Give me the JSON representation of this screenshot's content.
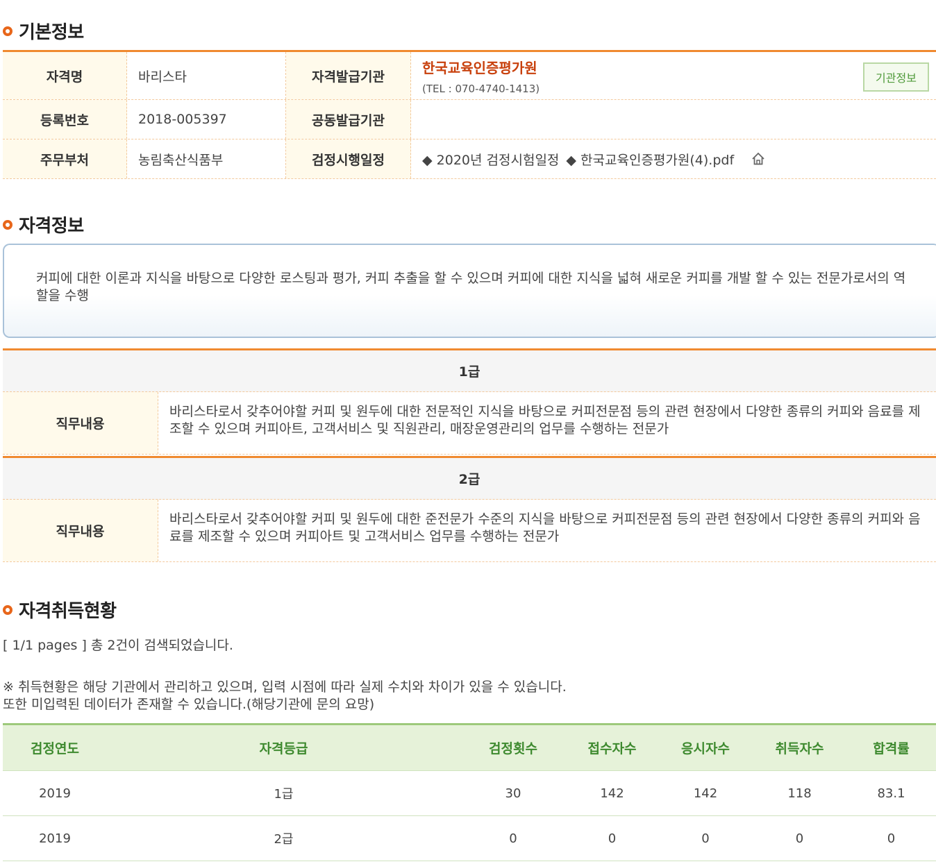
{
  "sections": {
    "basic_title": "기본정보",
    "qual_title": "자격정보",
    "status_title": "자격취득현황"
  },
  "basic": {
    "name_label": "자격명",
    "name_value": "바리스타",
    "issuer_label": "자격발급기관",
    "issuer_name": "한국교육인증평가원",
    "issuer_tel": "(TEL : 070-4740-1413)",
    "org_button": "기관정보",
    "reg_label": "등록번호",
    "reg_value": "2018-005397",
    "joint_label": "공동발급기관",
    "joint_value": "",
    "ministry_label": "주무부처",
    "ministry_value": "농림축산식품부",
    "schedule_label": "검정시행일정",
    "schedule_item1": "◆ 2020년 검정시험일정",
    "schedule_item2": "◆ 한국교육인증평가원(4).pdf"
  },
  "qual_desc": "커피에 대한 이론과 지식을 바탕으로 다양한 로스팅과 평가, 커피 추출을 할 수 있으며 커피에 대한 지식을 넓혀 새로운 커피를 개발 할 수 있는 전문가로서의 역할을 수행",
  "grades": [
    {
      "name": "1급",
      "duty_label": "직무내용",
      "duty": "바리스타로서 갖추어야할 커피 및 원두에 대한 전문적인 지식을 바탕으로 커피전문점 등의 관련 현장에서 다양한 종류의 커피와 음료를 제조할 수 있으며 커피아트, 고객서비스 및 직원관리, 매장운영관리의 업무를 수행하는 전문가"
    },
    {
      "name": "2급",
      "duty_label": "직무내용",
      "duty": "바리스타로서 갖추어야할 커피 및 원두에 대한 준전문가 수준의 지식을 바탕으로 커피전문점 등의 관련 현장에서 다양한 종류의 커피와 음료를 제조할 수 있으며 커피아트 및 고객서비스 업무를 수행하는 전문가"
    }
  ],
  "status": {
    "pages": "[ 1/1 pages ] 총 2건이 검색되었습니다.",
    "notice1": "※ 취득현황은 해당 기관에서 관리하고 있으며, 입력 시점에 따라 실제 수치와 차이가 있을 수 있습니다.",
    "notice2": "또한 미입력된 데이터가 존재할 수 있습니다.(해당기관에 문의 요망)",
    "headers": [
      "검정연도",
      "자격등급",
      "검정횟수",
      "접수자수",
      "응시자수",
      "취득자수",
      "합격률"
    ],
    "rows": [
      [
        "2019",
        "1급",
        "30",
        "142",
        "142",
        "118",
        "83.1"
      ],
      [
        "2019",
        "2급",
        "0",
        "0",
        "0",
        "0",
        "0"
      ]
    ]
  },
  "colors": {
    "accent_orange": "#f08a30",
    "issuer_red": "#c8400c",
    "table_green": "#3e8a2f"
  },
  "icons": [
    "bullet-icon",
    "home-icon"
  ]
}
